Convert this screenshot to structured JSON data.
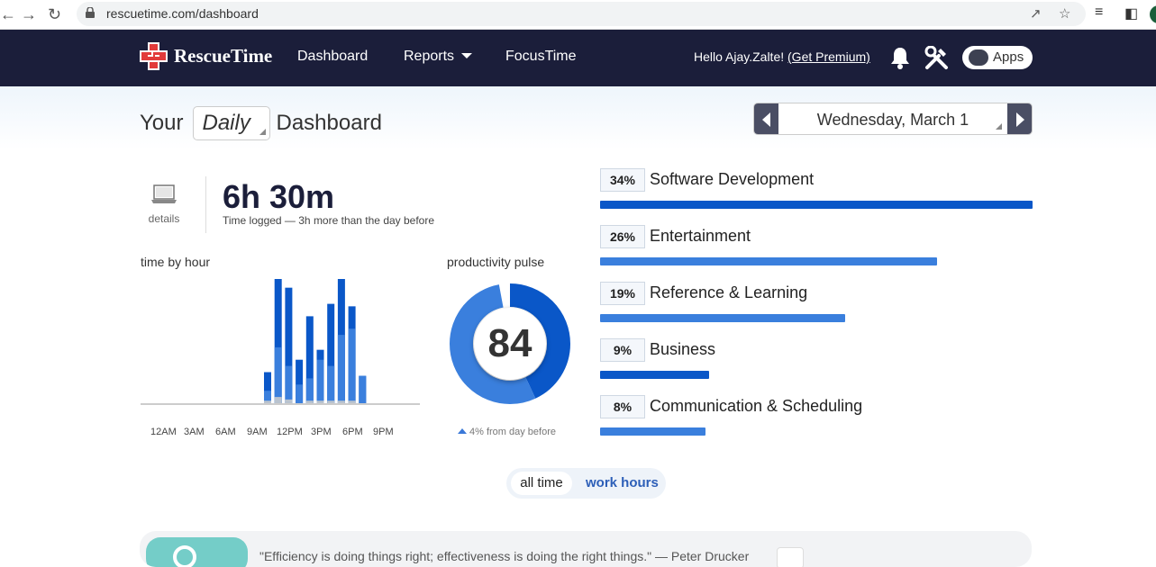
{
  "browser": {
    "url": "rescuetime.com/dashboard"
  },
  "nav": {
    "brand": "RescueTime",
    "links": [
      "Dashboard",
      "Reports",
      "FocusTime"
    ],
    "greeting": "Hello Ajay.Zalte! ",
    "premium": "(Get Premium)",
    "apps": "Apps"
  },
  "header": {
    "prefix": "Your",
    "period": "Daily",
    "suffix": "Dashboard",
    "date": "Wednesday, March 1"
  },
  "summary": {
    "details": "details",
    "total": "6h 30m",
    "note": "Time logged — 3h more than the day before"
  },
  "time_by_hour": {
    "label": "time by hour",
    "hour_labels": [
      "12AM",
      "3AM",
      "6AM",
      "9AM",
      "12PM",
      "3PM",
      "6PM",
      "9PM"
    ]
  },
  "pulse": {
    "label": "productivity pulse",
    "score": "84",
    "note": "4% from day before",
    "productive_fraction": 0.43,
    "neutral_fraction": 0.03,
    "colors": {
      "productive": "#0a57c8",
      "very_productive": "#3a7fdd",
      "neutral": "#b9c3cf"
    }
  },
  "categories": [
    {
      "pct": "34%",
      "name": "Software Development",
      "share": 1.0,
      "color": "#0a57c8"
    },
    {
      "pct": "26%",
      "name": "Entertainment",
      "share": 0.78,
      "color": "#3a7fdd"
    },
    {
      "pct": "19%",
      "name": "Reference & Learning",
      "share": 0.567,
      "color": "#3a7fdd"
    },
    {
      "pct": "9%",
      "name": "Business",
      "share": 0.252,
      "color": "#0a57c8"
    },
    {
      "pct": "8%",
      "name": "Communication & Scheduling",
      "share": 0.244,
      "color": "#3a7fdd"
    }
  ],
  "toggle": {
    "options": [
      "all time",
      "work hours"
    ]
  },
  "quote": {
    "text": "\"Efficiency is doing things right; effectiveness is doing the right things.\" — Peter Drucker"
  },
  "chart_data": {
    "type": "bar",
    "title": "time by hour",
    "categories": [
      "9AM",
      "10AM",
      "11AM",
      "12PM",
      "1PM",
      "2PM",
      "3PM",
      "4PM",
      "5PM",
      "6PM",
      "7PM",
      "8PM"
    ],
    "series": [
      {
        "values": [
          0.25,
          1.0,
          0.93,
          0.35,
          0.7,
          0.43,
          0.8,
          1.0,
          0.78,
          0.22,
          0.0,
          0.0
        ]
      },
      {
        "values": [
          0.1,
          0.45,
          0.3,
          0.15,
          0.2,
          0.35,
          0.3,
          0.55,
          0.6,
          0.25,
          0.0,
          0.0
        ]
      },
      {
        "values": [
          0.02,
          0.05,
          0.03,
          0.0,
          0.02,
          0.02,
          0.02,
          0.02,
          0.02,
          0.0,
          0.0,
          0.0
        ]
      }
    ]
  }
}
